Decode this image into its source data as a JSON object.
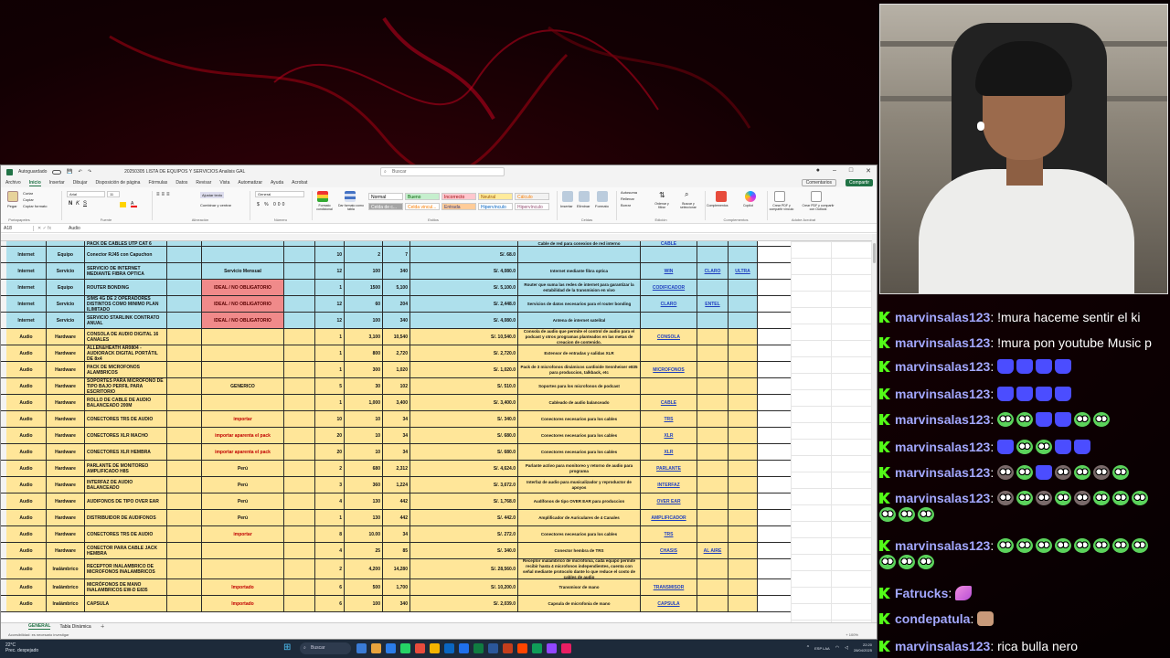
{
  "excel": {
    "autosave_label": "Autoguardado",
    "filename": "20250305 LISTA DE EQUIPOS Y SERVICIOS Analisis GAL",
    "search_placeholder": "Buscar",
    "tabs": [
      "Archivo",
      "Inicio",
      "Insertar",
      "Dibujar",
      "Disposición de página",
      "Fórmulas",
      "Datos",
      "Revisar",
      "Vista",
      "Automatizar",
      "Ayuda",
      "Acrobat"
    ],
    "active_tab": "Inicio",
    "comments_label": "Comentarios",
    "share_label": "Compartir",
    "ribbon": {
      "clipboard": "Portapapeles",
      "font": "Fuente",
      "alignment": "Alineación",
      "number": "Número",
      "styles": "Estilos",
      "cells": "Celdas",
      "editing": "Edición",
      "addins": "Complementos",
      "adobe": "Adobe Acrobat",
      "paste": "Pegar",
      "font_name": "Arial",
      "font_size": "11",
      "wrap": "Ajustar texto",
      "merge": "Combinar y centrar",
      "number_format": "General",
      "cond_format": "Formato condicional",
      "table_format": "Dar formato como tabla",
      "insert": "Insertar",
      "delete": "Eliminar",
      "format": "Formato",
      "sort": "Ordenar y filtrar",
      "find": "Buscar y seleccionar",
      "addins_btn": "Complementos",
      "copilot": "Copilot",
      "create_pdf": "Crear PDF y compartir vínculo",
      "create_pdf_outlook": "Crear PDF y compartir con Outlook",
      "autosum": "Autosuma",
      "fill": "Rellenar",
      "clear": "Borrar",
      "cut": "Cortar",
      "copy": "Copiar",
      "format_painter": "Copiar formato"
    },
    "styles": [
      {
        "label": "Normal",
        "bg": "#ffffff",
        "fg": "#000000"
      },
      {
        "label": "Bueno",
        "bg": "#c6efce",
        "fg": "#006100"
      },
      {
        "label": "Incorrecto",
        "bg": "#ffc7ce",
        "fg": "#9c0006"
      },
      {
        "label": "Neutral",
        "bg": "#ffeb9c",
        "fg": "#9c5700"
      },
      {
        "label": "Cálculo",
        "bg": "#f2f2f2",
        "fg": "#fa7d00"
      },
      {
        "label": "Celda de c...",
        "bg": "#a5a5a5",
        "fg": "#ffffff"
      },
      {
        "label": "Celda vincul...",
        "bg": "#ffffff",
        "fg": "#fa7d00"
      },
      {
        "label": "Entrada",
        "bg": "#ffcc99",
        "fg": "#3f3f76"
      },
      {
        "label": "Hipervínculo",
        "bg": "#ffffff",
        "fg": "#0563c1"
      },
      {
        "label": "Hipervínculo",
        "bg": "#ffffff",
        "fg": "#954f72"
      }
    ],
    "name_box": "A18",
    "formula": "Audio",
    "rows": [
      {
        "bg": "blue",
        "cat": "Internet",
        "type": "Servicio",
        "desc": "SERVICIO DE INTERNET MEDIANTE FIBRA OPTICA",
        "note": "Servicio Mensual",
        "note_style": "",
        "qty": "12",
        "price": "100",
        "total": "340",
        "sol": "S/. 4,080.0",
        "func": "Internet mediante fibra optica",
        "link1": "WIN",
        "link2": "CLARO",
        "link3": "ULTRA"
      },
      {
        "bg": "blue",
        "cat": "Internet",
        "type": "Equipo",
        "desc": "ROUTER BONDING",
        "note": "IDEAL / NO OBLIGATORIO",
        "note_style": "pink",
        "qty": "1",
        "price": "1500",
        "total": "5,100",
        "sol": "S/. 5,100.0",
        "func": "Router que suma las redes de internet para garantizar la estabilidad de la transmision en vivo",
        "link1": "CODIFICADOR",
        "link2": "",
        "link3": ""
      },
      {
        "bg": "blue",
        "cat": "Internet",
        "type": "Servicio",
        "desc": "SIMS 4G DE 2 OPERADORES DISTINTOS COMO MINIMO PLAN ILIMITADO",
        "note": "IDEAL / NO OBLIGATORIO",
        "note_style": "pink",
        "qty": "12",
        "price": "60",
        "total": "204",
        "sol": "S/. 2,448.0",
        "func": "Servicios de datos necesarios para el router bonding",
        "link1": "CLARO",
        "link2": "ENTEL",
        "link3": ""
      },
      {
        "bg": "blue",
        "cat": "Internet",
        "type": "Servicio",
        "desc": "SERVICIO STARLINK CONTRATO ANUAL",
        "note": "IDEAL / NO OBLIGATORIO",
        "note_style": "pink",
        "qty": "12",
        "price": "100",
        "total": "340",
        "sol": "S/. 4,080.0",
        "func": "Antena de internet satelital",
        "link1": "",
        "link2": "",
        "link3": ""
      },
      {
        "bg": "yellow",
        "cat": "Audio",
        "type": "Hardware",
        "desc": "CONSOLA DE AUDIO DIGITAL 16 CANALES",
        "note": "",
        "note_style": "",
        "qty": "1",
        "price": "3,100",
        "total": "10,540",
        "sol": "S/. 10,540.0",
        "func": "Consola de audio que permite el control de audio para el podcast y otros programas planteados en las metas de creacion de contenido.",
        "link1": "CONSOLA",
        "link2": "",
        "link3": ""
      },
      {
        "bg": "yellow",
        "cat": "Audio",
        "type": "Hardware",
        "desc": "ALLEN&HEATH AR0804 - AUDIORACK DIGITAL PORTÁTIL DE 8x4",
        "note": "",
        "note_style": "",
        "qty": "1",
        "price": "800",
        "total": "2,720",
        "sol": "S/. 2,720.0",
        "func": "Extensor de entradas y salidas XLR",
        "link1": "",
        "link2": "",
        "link3": ""
      },
      {
        "bg": "yellow",
        "cat": "Audio",
        "type": "Hardware",
        "desc": "PACK DE MICROFONOS ALAMBRICOS",
        "note": "",
        "note_style": "",
        "qty": "1",
        "price": "300",
        "total": "1,020",
        "sol": "S/. 1,020.0",
        "func": "Pack de 3 microfonos dinámicos cardioide Sennheiser e835 para produccion, talkback, etc",
        "link1": "MICROFONOS",
        "link2": "",
        "link3": ""
      },
      {
        "bg": "yellow",
        "cat": "Audio",
        "type": "Hardware",
        "desc": "SOPORTES PARA MICROFONO DE TIPO BAJO PERFIL PARA ESCRITORIO",
        "note": "GENERICO",
        "note_style": "",
        "qty": "5",
        "price": "30",
        "total": "102",
        "sol": "S/. 510.0",
        "func": "Soportes para los microfonos de podcast",
        "link1": "",
        "link2": "",
        "link3": ""
      },
      {
        "bg": "yellow",
        "cat": "Audio",
        "type": "Hardware",
        "desc": "ROLLO DE CABLE DE AUDIO BALANCEADO 200M",
        "note": "",
        "note_style": "",
        "qty": "1",
        "price": "1,000",
        "total": "3,400",
        "sol": "S/. 3,400.0",
        "func": "Cableado de audio balanceado",
        "link1": "CABLE",
        "link2": "",
        "link3": ""
      },
      {
        "bg": "yellow",
        "cat": "Audio",
        "type": "Hardware",
        "desc": "CONECTORES TRS DE AUDIO",
        "note": "importar",
        "note_style": "red",
        "qty": "10",
        "price": "10",
        "total": "34",
        "sol": "S/. 340.0",
        "func": "Conectores necesarios para los cables",
        "link1": "TRS",
        "link2": "",
        "link3": ""
      },
      {
        "bg": "yellow",
        "cat": "Audio",
        "type": "Hardware",
        "desc": "CONECTORES XLR MACHO",
        "note": "importar aparenta el pack",
        "note_style": "red",
        "qty": "20",
        "price": "10",
        "total": "34",
        "sol": "S/. 680.0",
        "func": "Conectores necesarios para los cables",
        "link1": "XLR",
        "link2": "",
        "link3": ""
      },
      {
        "bg": "yellow",
        "cat": "Audio",
        "type": "Hardware",
        "desc": "CONECTORES XLR HEMBRA",
        "note": "importar aparenta el pack",
        "note_style": "red",
        "qty": "20",
        "price": "10",
        "total": "34",
        "sol": "S/. 680.0",
        "func": "Conectores necesarios para los cables",
        "link1": "XLR",
        "link2": "",
        "link3": ""
      },
      {
        "bg": "yellow",
        "cat": "Audio",
        "type": "Hardware",
        "desc": "PARLANTE DE MONITOREO AMPLIFICADO H8S",
        "note": "Perú",
        "note_style": "",
        "qty": "2",
        "price": "680",
        "total": "2,312",
        "sol": "S/. 4,624.0",
        "func": "Parlante activo para monitoreo y retorno de audio para programa",
        "link1": "PARLANTE",
        "link2": "",
        "link3": ""
      },
      {
        "bg": "yellow",
        "cat": "Audio",
        "type": "Hardware",
        "desc": "INTERFAZ DE AUDIO BALANCEADO",
        "note": "Perú",
        "note_style": "",
        "qty": "3",
        "price": "360",
        "total": "1,224",
        "sol": "S/. 3,672.0",
        "func": "Interfaz de audio para musicalizador y reproductor de apoyos",
        "link1": "INTERFAZ",
        "link2": "",
        "link3": ""
      },
      {
        "bg": "yellow",
        "cat": "Audio",
        "type": "Hardware",
        "desc": "AUDIFONOS DE TIPO OVER EAR",
        "note": "Perú",
        "note_style": "",
        "qty": "4",
        "price": "130",
        "total": "442",
        "sol": "S/. 1,768.0",
        "func": "Audífonos de tipo OVER EAR para produccion",
        "link1": "OVER EAR",
        "link2": "",
        "link3": ""
      },
      {
        "bg": "yellow",
        "cat": "Audio",
        "type": "Hardware",
        "desc": "DISTRIBUIDOR DE AUDIFONOS",
        "note": "Perú",
        "note_style": "",
        "qty": "1",
        "price": "130",
        "total": "442",
        "sol": "S/. 442.0",
        "func": "Amplificador de Auriculares de 4 Canales",
        "link1": "AMPLIFICADOR",
        "link2": "",
        "link3": ""
      },
      {
        "bg": "yellow",
        "cat": "Audio",
        "type": "Hardware",
        "desc": "CONECTORES TRS DE AUDIO",
        "note": "importar",
        "note_style": "red",
        "qty": "8",
        "price": "10.00",
        "total": "34",
        "sol": "S/. 272.0",
        "func": "Conectores necesarios para los cables",
        "link1": "TRS",
        "link2": "",
        "link3": ""
      },
      {
        "bg": "yellow",
        "cat": "Audio",
        "type": "Hardware",
        "desc": "CONECTOR PARA CABLE JACK HEMBRA",
        "note": "",
        "note_style": "",
        "qty": "4",
        "price": "25",
        "total": "85",
        "sol": "S/. 340.0",
        "func": "Conector hembra de TRS",
        "link1": "CHASIS",
        "link2": "AL AIRE",
        "link3": ""
      },
      {
        "bg": "yellow",
        "cat": "Audio",
        "type": "Inalámbrico",
        "desc": "RECEPTOR INALAMBRICO DE MICROFONOS INALAMBRICOS",
        "note": "",
        "note_style": "",
        "qty": "2",
        "price": "4,200",
        "total": "14,280",
        "sol": "S/. 28,560.0",
        "func": "Receptor inalambrico de microfonia, cada equipo permite recibir hasta 4 microfonos independientes, cuenta con señal mediante protocolo dante lo que reduce el costo de cables de audio",
        "link1": "",
        "link2": "",
        "link3": ""
      },
      {
        "bg": "yellow",
        "cat": "Audio",
        "type": "Inalámbrico",
        "desc": "MICRÓFONOS DE MANO INALAMBRICOS EW-D E835",
        "note": "Importado",
        "note_style": "red",
        "qty": "6",
        "price": "500",
        "total": "1,700",
        "sol": "S/. 10,200.0",
        "func": "Transmisor de mano",
        "link1": "TRANSMISOR",
        "link2": "",
        "link3": ""
      },
      {
        "bg": "yellow",
        "cat": "Audio",
        "type": "Inalámbrico",
        "desc": "CAPSULA",
        "note": "Importado",
        "note_style": "red",
        "qty": "6",
        "price": "100",
        "total": "340",
        "sol": "S/. 2,039.0",
        "func": "Capsula de microfonia de mano",
        "link1": "CAPSULA",
        "link2": "",
        "link3": ""
      }
    ],
    "top_partial_row": {
      "desc": "PACK DE CABLES UTP CAT 6",
      "func": "Cable de red para conexion de red interno",
      "link1": "CABLE"
    },
    "top_partial_row2": {
      "cat": "Internet",
      "type": "Equipo",
      "desc": "Conector RJ45 con Capuchon",
      "qty": "10",
      "price": "2",
      "total": "7",
      "sol": "S/. 68.0"
    },
    "sheets": [
      "GENERAL",
      "Tabla Dinámica"
    ],
    "status": "Accesibilidad: es necesario investigar",
    "zoom": "+ 100%"
  },
  "taskbar": {
    "temp": "22°C",
    "weather": "Prec. despejado",
    "search": "Buscar",
    "time": "22:20",
    "date": "28/04/2025",
    "lang": "ESP LAA",
    "apps": [
      "#3a7bd5",
      "#e8a33d",
      "#2b7de9",
      "#25d366",
      "#e94b3c",
      "#f4b400",
      "#0a66c2",
      "#1f6feb",
      "#107c41",
      "#2b579a",
      "#c43e1c",
      "#ff4500",
      "#0f9d58",
      "#9146ff",
      "#e91e63"
    ]
  },
  "chat": [
    {
      "user": "marvinsalas123",
      "text": "!mura haceme sentir el ki",
      "emotes": []
    },
    {
      "user": "marvinsalas123",
      "text": "!mura pon youtube Music p",
      "emotes": []
    },
    {
      "user": "marvinsalas123",
      "text": "",
      "emotes": [
        "blue",
        "blue",
        "blue",
        "blue"
      ]
    },
    {
      "user": "marvinsalas123",
      "text": "",
      "emotes": [
        "blue",
        "blue",
        "blue",
        "blue"
      ]
    },
    {
      "user": "marvinsalas123",
      "text": "",
      "emotes": [
        "frog",
        "frog",
        "blue",
        "blue",
        "frog",
        "frog"
      ]
    },
    {
      "user": "marvinsalas123",
      "text": "",
      "emotes": [
        "blue",
        "frog",
        "frog",
        "blue",
        "blue"
      ]
    },
    {
      "user": "marvinsalas123",
      "text": "",
      "emotes": [
        "frogdark",
        "frog",
        "blue",
        "frogdark",
        "frog",
        "frogdark",
        "frog"
      ]
    },
    {
      "user": "marvinsalas123",
      "text": "",
      "emotes": [
        "frogdark",
        "frog",
        "frogdark",
        "frog",
        "frogdark",
        "frog",
        "frog",
        "frog",
        "frog",
        "frog",
        "frog"
      ]
    },
    {
      "user": "marvinsalas123",
      "text": "",
      "emotes": [
        "frog",
        "frog",
        "frog",
        "frog",
        "frog",
        "frog",
        "frog",
        "frog",
        "frog",
        "frog",
        "frog"
      ]
    },
    {
      "user": "Fatrucks",
      "text": "",
      "emotes": [
        "feather"
      ]
    },
    {
      "user": "condepatula",
      "text": "",
      "emotes": [
        "face"
      ]
    },
    {
      "user": "marvinsalas123",
      "text": "rica bulla nero",
      "emotes": []
    }
  ]
}
